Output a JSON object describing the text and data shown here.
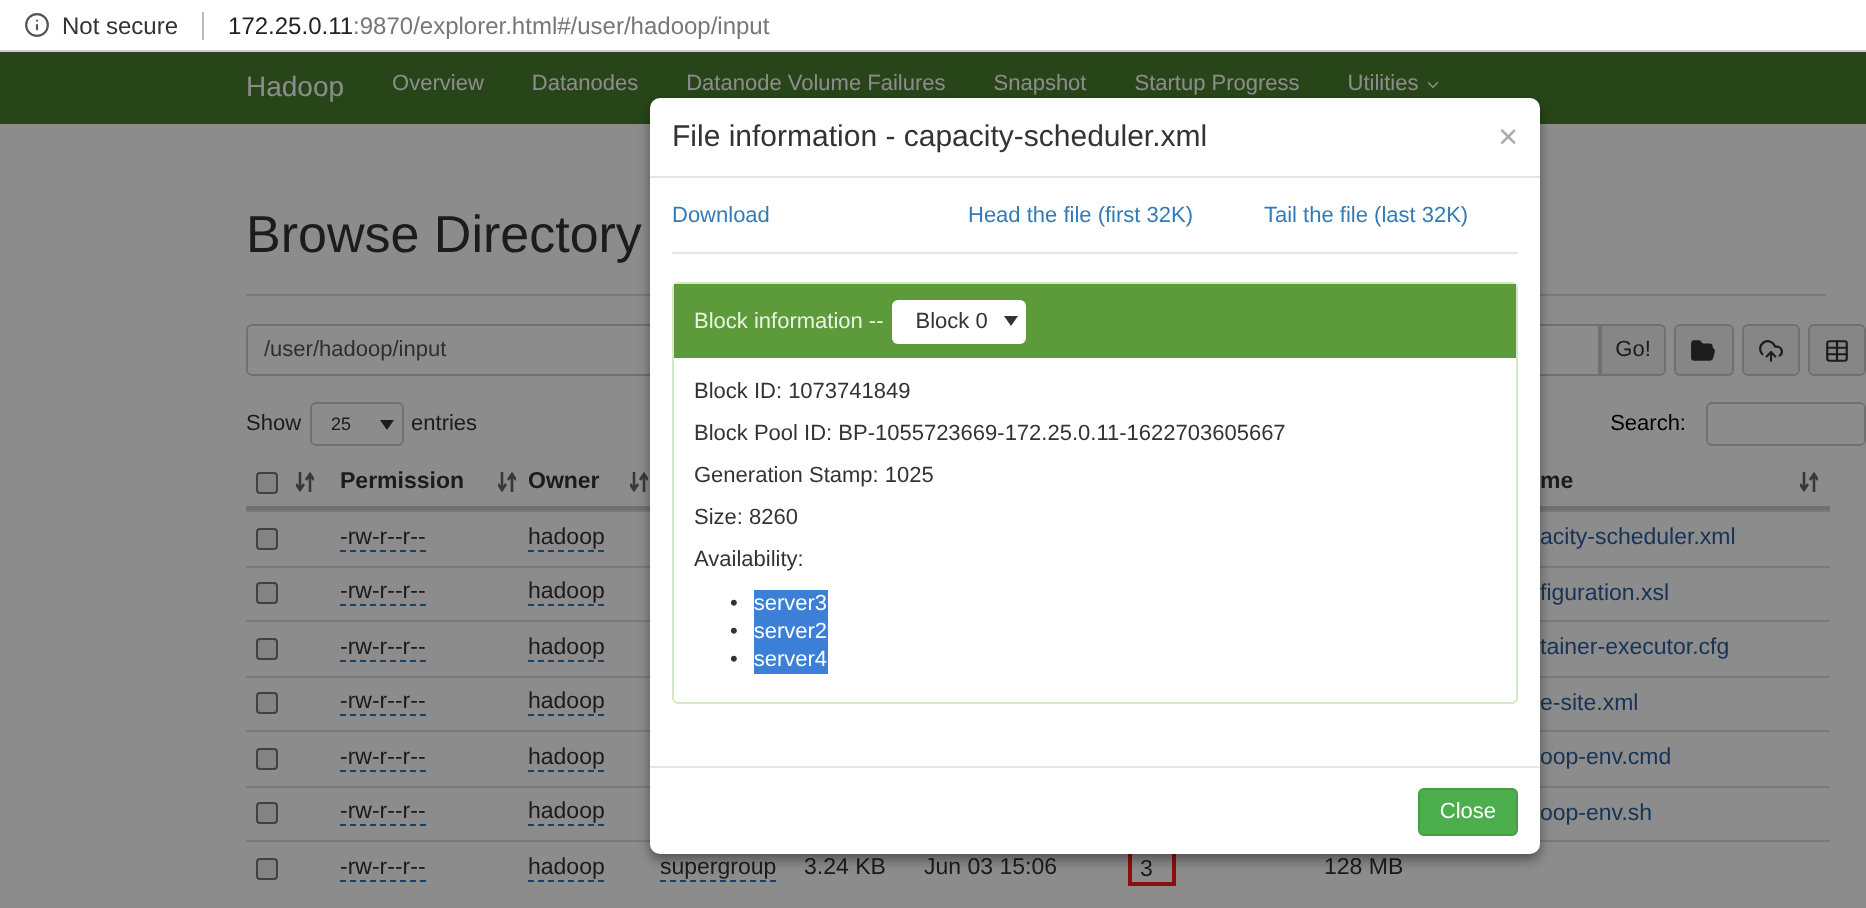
{
  "browser": {
    "security": "Not secure",
    "url_host": "172.25.0.11",
    "url_rest": ":9870/explorer.html#/user/hadoop/input"
  },
  "navbar": {
    "brand": "Hadoop",
    "items": [
      {
        "label": "Overview",
        "kind": "link"
      },
      {
        "label": "Datanodes",
        "kind": "link"
      },
      {
        "label": "Datanode Volume Failures",
        "kind": "link"
      },
      {
        "label": "Snapshot",
        "kind": "link"
      },
      {
        "label": "Startup Progress",
        "kind": "link"
      },
      {
        "label": "Utilities",
        "kind": "dropdown"
      }
    ]
  },
  "page": {
    "title": "Browse Directory",
    "path": "/user/hadoop/input",
    "go": "Go!",
    "show": "Show",
    "page_size": "25",
    "entries": "entries",
    "search_label": "Search:"
  },
  "table": {
    "header": {
      "permission": "Permission",
      "owner": "Owner",
      "name": "me",
      "checked": false
    },
    "rows": [
      {
        "checked": false,
        "permission": "-rw-r--r--",
        "owner": "hadoop",
        "name": "acity-scheduler.xml"
      },
      {
        "checked": false,
        "permission": "-rw-r--r--",
        "owner": "hadoop",
        "name": "figuration.xsl"
      },
      {
        "checked": false,
        "permission": "-rw-r--r--",
        "owner": "hadoop",
        "name": "tainer-executor.cfg"
      },
      {
        "checked": false,
        "permission": "-rw-r--r--",
        "owner": "hadoop",
        "name": "e-site.xml"
      },
      {
        "checked": false,
        "permission": "-rw-r--r--",
        "owner": "hadoop",
        "name": "oop-env.cmd"
      },
      {
        "checked": false,
        "permission": "-rw-r--r--",
        "owner": "hadoop",
        "name": "oop-env.sh"
      },
      {
        "checked": false,
        "permission": "-rw-r--r--",
        "owner": "hadoop",
        "group": "supergroup",
        "size": "3.24 KB",
        "modified": "Jun 03 15:06",
        "replication": "3",
        "replication_marked": true,
        "block_size": "128 MB"
      }
    ]
  },
  "modal": {
    "title": "File information - capacity-scheduler.xml",
    "close_icon": "×",
    "links": [
      "Download",
      "Head the file (first 32K)",
      "Tail the file (last 32K)"
    ],
    "block_label": "Block information --",
    "block_select": "Block 0",
    "details": [
      "Block ID: 1073741849",
      "Block Pool ID: BP-1055723669-172.25.0.11-1622703605667",
      "Generation Stamp: 1025",
      "Size: 8260",
      "Availability:"
    ],
    "bullet": "•",
    "servers": [
      {
        "name": "server3",
        "selected": true
      },
      {
        "name": "server2",
        "selected": true
      },
      {
        "name": "server4",
        "selected": true
      }
    ],
    "close": "Close"
  }
}
